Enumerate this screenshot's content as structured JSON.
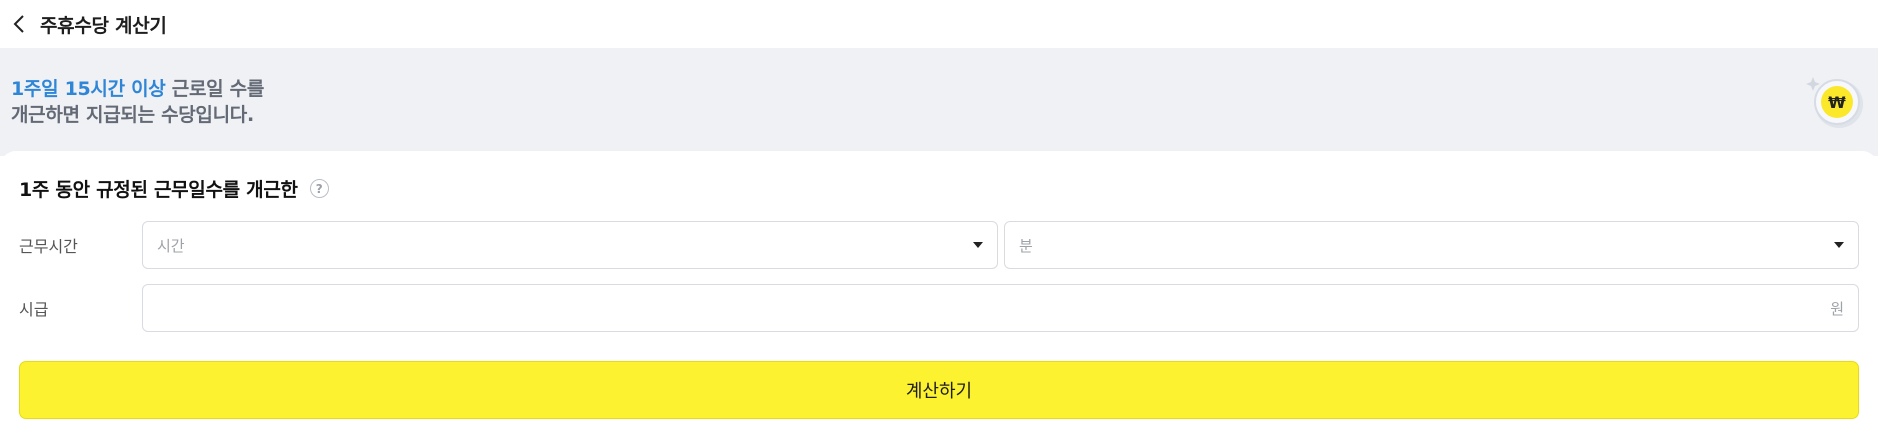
{
  "header": {
    "title": "주휴수당 계산기"
  },
  "banner": {
    "highlight": "1주일 15시간 이상",
    "line1_rest": " 근로일 수를",
    "line2": "개근하면 지급되는 수당입니다.",
    "coin_symbol": "₩"
  },
  "form": {
    "heading": "1주 동안 규정된 근무일수를 개근한",
    "help_symbol": "?",
    "work_time_label": "근무시간",
    "hours_placeholder": "시간",
    "minutes_placeholder": "분",
    "wage_label": "시급",
    "wage_unit": "원"
  },
  "actions": {
    "calculate_label": "계산하기"
  },
  "colors": {
    "accent_yellow": "#fcf22f",
    "highlight_blue": "#2f86d6",
    "banner_bg": "#eff1f5"
  }
}
